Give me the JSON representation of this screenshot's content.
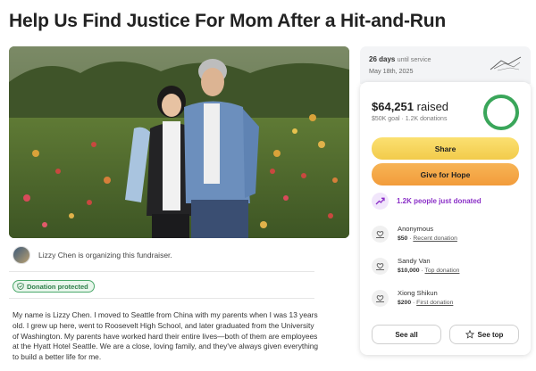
{
  "page": {
    "title": "Help Us Find Justice For Mom After a Hit-and-Run"
  },
  "organizer": {
    "text": "Lizzy Chen is organizing this fundraiser."
  },
  "badge": {
    "label": "Donation protected"
  },
  "story": {
    "text": "My name is Lizzy Chen. I moved to Seattle from China with my parents when I was 13 years old. I grew up here, went to Roosevelt High School, and later graduated from the University of Washington. My parents have worked hard their entire lives—both of them are employees at the Hyatt Hotel Seattle. We are a close, loving family, and they've always given everything to build a better life for me."
  },
  "service": {
    "days": "26 days",
    "suffix": "until service",
    "date": "May 18th, 2025"
  },
  "fundraiser": {
    "raised": "$64,251",
    "raised_word": "raised",
    "goal_line": "$50K goal · 1.2K donations",
    "progress_fraction": 1.0,
    "share_label": "Share",
    "give_label": "Give for Hope",
    "people_label": "1.2K people just donated"
  },
  "donations": [
    {
      "name": "Anonymous",
      "amount": "$50",
      "tag": "Recent donation"
    },
    {
      "name": "Sandy Van",
      "amount": "$10,000",
      "tag": "Top donation"
    },
    {
      "name": "Xiong Shikun",
      "amount": "$200",
      "tag": "First donation"
    }
  ],
  "actions": {
    "see_all": "See all",
    "see_top": "See top"
  },
  "colors": {
    "progress": "#3aa65a",
    "share": "#f2cb4b",
    "give": "#f29c3b",
    "accent_purple": "#8a2fc7",
    "protected_green": "#2d7e49"
  },
  "icons": {
    "people": "trending-up-icon",
    "donor": "hands-heart-icon",
    "see_top": "star-icon",
    "badge": "shield-check-icon"
  }
}
